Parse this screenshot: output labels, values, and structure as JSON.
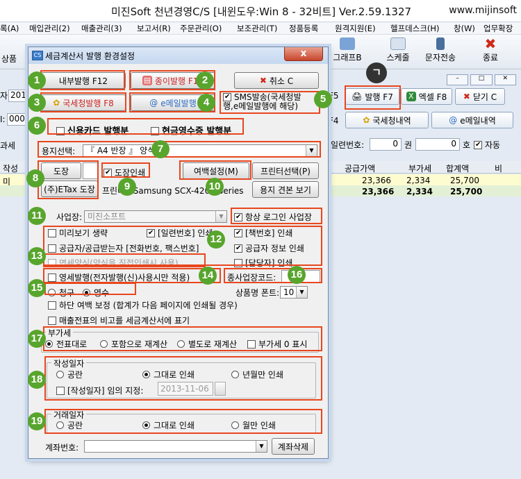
{
  "app": {
    "title": "미진Soft 천년경영C/S [내윈도우:Win 8 - 32비트] Ver.2.59.1327",
    "site": "www.mijinsoft"
  },
  "menu": [
    "록(A)",
    "매입관리(2)",
    "매출관리(3)",
    "보고서(R)",
    "주문관리(O)",
    "보조관리(T)",
    "정품등록",
    "원격지원(E)",
    "헬프데스크(H)",
    "창(W)",
    "업무확장"
  ],
  "toolbar": {
    "left_label": "상품",
    "graph_label": "그래프B",
    "schedule_label": "스케줄",
    "sms_label": "문자전송",
    "exit_label": "종료"
  },
  "back": {
    "issue_btn": "발행 F7",
    "excel_btn": "엑셀 F8",
    "close_btn": "닫기 C",
    "f5": "F5",
    "f4": "F4",
    "nts_history": "국세청내역",
    "email_history": "e메일내역",
    "left_field1": "2013",
    "left_field2": "0000",
    "left_label1": "자:",
    "left_label2": "I:",
    "left_label3": "과세",
    "left_col_header": "작성",
    "left_cell": "미",
    "serial_label": "일련번호:",
    "serial_val1": "0",
    "serial_unit1": "권",
    "serial_val2": "0",
    "serial_unit2": "호",
    "auto_label": "자동",
    "col_supply": "공급가액",
    "col_vat": "부가세",
    "col_total": "합계액",
    "col_extra": "비",
    "row1": {
      "supply": "23,366",
      "vat": "2,334",
      "total": "25,700"
    },
    "row2": {
      "supply": "23,366",
      "vat": "2,334",
      "total": "25,700"
    },
    "badge": "ㄱ"
  },
  "dialog": {
    "title": "세금계산서 발행 환경설정",
    "close_glyph": "x",
    "btn_internal": "내부발행 F12",
    "btn_paper": "종이발행 F11",
    "btn_cancel": "취소 C",
    "btn_nts": "국세청발행 F8",
    "btn_email": "e메일발행",
    "sms_text": "SMS발송(국세청발행,e메일발행에 해당)",
    "card_label": "신용카드 발행분",
    "cash_label": "현금영수증 발행분",
    "paper_select_label": "용지선택:",
    "paper_select_value": "『 A4 반장 』 양식",
    "stamp_btn": "도장",
    "stamp_print": "도장인쇄",
    "margin_btn": "여백설정(M)",
    "printer_btn": "프린터선택(P)",
    "etax_btn": "(주)ETax 도장",
    "printer_label": "프린터 : Samsung SCX-4200 Series",
    "sample_btn": "용지 견본 보기",
    "site_label": "사업장:",
    "site_value": "미진소프트",
    "always_login": "항상 로그인 사업장",
    "opt_preview": "미리보기 생략",
    "opt_serial": "[일련번호] 인쇄",
    "opt_book": "[책번호] 인쇄",
    "opt_contact": "공급자/공급받는자 [전화번호, 팩스번호]",
    "opt_supplier": "공급자 정보 인쇄",
    "opt_manager": "[담당자] 인쇄",
    "opt_taxfree": "면세양식(양식을 직접인쇄시 사용)",
    "opt_zero": "영세발행(전자발행(신)사용시만 적용)",
    "sub_code_label": "종사업장코드:",
    "claim": "청구",
    "receipt": "영수",
    "font_label": "상품명 폰트:",
    "font_value": "10",
    "bottom_margin": "하단 여백 보정 (합계가 다음 페이지에 인쇄될 경우)",
    "memo_label": "매출전표의 비고를 세금계산서에 표기",
    "vat_group": "부가세",
    "vat_opt1": "전표대로",
    "vat_opt2": "포함으로 재계산",
    "vat_opt3": "별도로 재계산",
    "vat_zero": "부가세 0 표시",
    "date_group": "작성일자",
    "date_opt1": "공란",
    "date_opt2": "그대로 인쇄",
    "date_opt3": "년월만 인쇄",
    "date_custom": "[작성일자] 임의 지정:",
    "date_value": "2013-11-06",
    "trade_group": "거래일자",
    "trade_opt1": "공란",
    "trade_opt2": "그대로 인쇄",
    "trade_opt3": "월만 인쇄",
    "account_label": "계좌번호:",
    "account_delete": "계좌삭제"
  },
  "markers": [
    "1",
    "2",
    "3",
    "4",
    "5",
    "6",
    "7",
    "8",
    "9",
    "10",
    "11",
    "12",
    "13",
    "14",
    "15",
    "16",
    "17",
    "18",
    "19"
  ],
  "colors": {
    "highlight": "#e8461e",
    "marker": "#58a52d",
    "selected_row": "#fdfbd0",
    "title_bar": "#c5d8ef"
  }
}
